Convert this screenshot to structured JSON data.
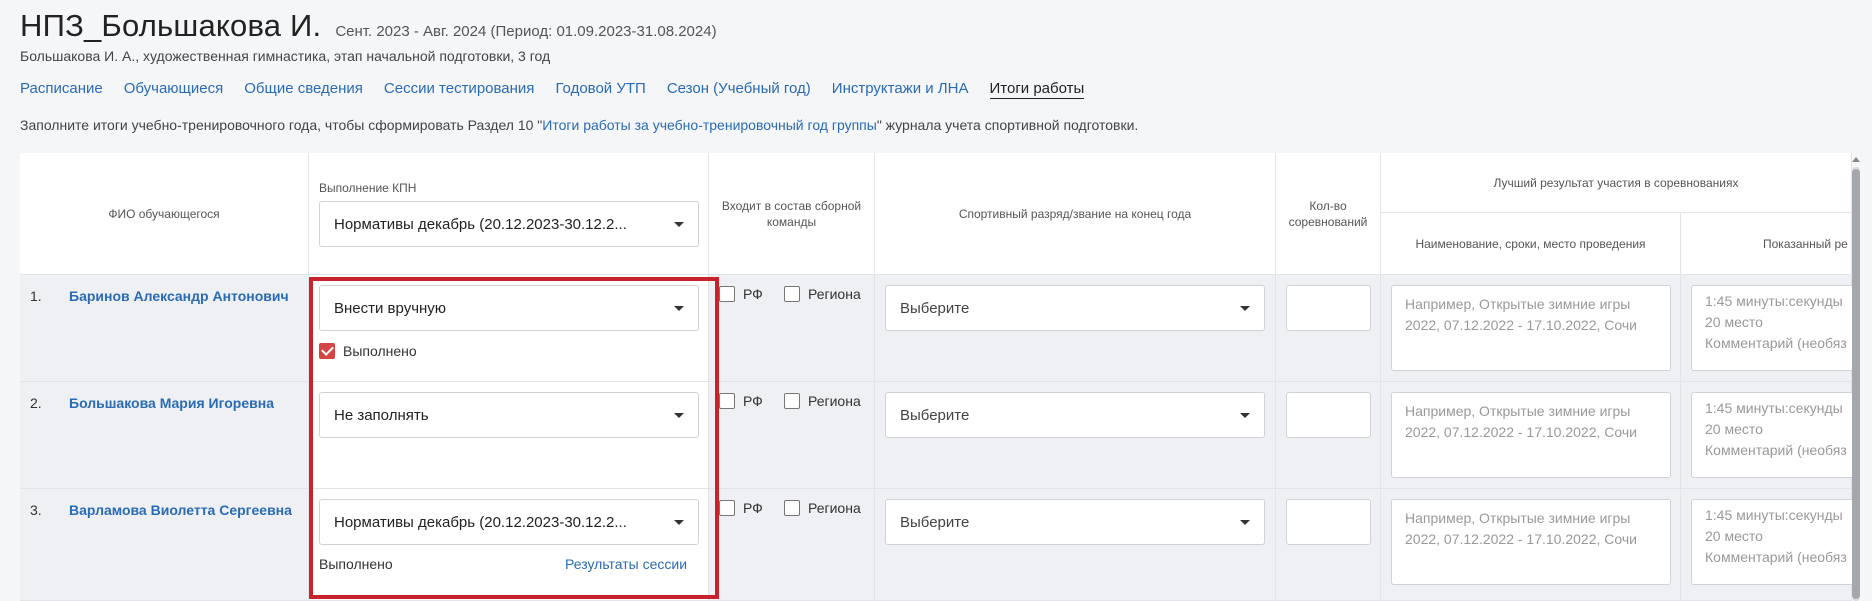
{
  "header": {
    "title": "НПЗ_Большакова И.",
    "period": "Сент. 2023 - Авг. 2024 (Период: 01.09.2023-31.08.2024)",
    "subtitle": "Большакова И. А., художественная гимнастика, этап начальной подготовки, 3 год"
  },
  "tabs": [
    {
      "label": "Расписание"
    },
    {
      "label": "Обучающиеся"
    },
    {
      "label": "Общие сведения"
    },
    {
      "label": "Сессии тестирования"
    },
    {
      "label": "Годовой УТП"
    },
    {
      "label": "Сезон (Учебный год)"
    },
    {
      "label": "Инструктажи и ЛНА"
    },
    {
      "label": "Итоги работы"
    }
  ],
  "hint": {
    "before": "Заполните итоги учебно-тренировочного года, чтобы сформировать Раздел 10 \"",
    "link": "Итоги работы за учебно-тренировочный год группы",
    "after": "\" журнала учета спортивной подготовки."
  },
  "table": {
    "headers": {
      "fio": "ФИО обучающегося",
      "kpn": "Выполнение КПН",
      "kpn_select": "Нормативы декабрь (20.12.2023-30.12.2...",
      "team": "Входит в состав сборной команды",
      "rank": "Спортивный разряд/звание на конец года",
      "count": "Кол-во соревнований",
      "best": "Лучший результат участия в соревнованиях",
      "best_name": "Наименование, сроки, место проведения",
      "best_result": "Показанный ре"
    },
    "checkbox_rf": "РФ",
    "checkbox_region": "Региона",
    "rank_placeholder": "Выберите",
    "competition_placeholder_1": "Например, Открытые зимние игры",
    "competition_placeholder_2": "2022, 07.12.2022 - 17.10.2022, Сочи",
    "result_placeholder_1": "1:45 минуты:секунды",
    "result_placeholder_2": "20 место",
    "result_placeholder_3": "Комментарий (необяз",
    "rows": [
      {
        "num": "1.",
        "name": "Баринов Александр Антонович",
        "kpn": "Внести вручную",
        "done_label": "Выполнено",
        "done_checked": true
      },
      {
        "num": "2.",
        "name": "Большакова Мария Игоревна",
        "kpn": "Не заполнять"
      },
      {
        "num": "3.",
        "name": "Варламова Виолетта Сергеевна",
        "kpn": "Нормативы декабрь (20.12.2023-30.12.2...",
        "done_text": "Выполнено",
        "results_link": "Результаты сессии"
      }
    ]
  },
  "colors": {
    "link": "#2a6bb5",
    "highlight": "#c8232c",
    "checkbox_checked": "#d64545"
  }
}
